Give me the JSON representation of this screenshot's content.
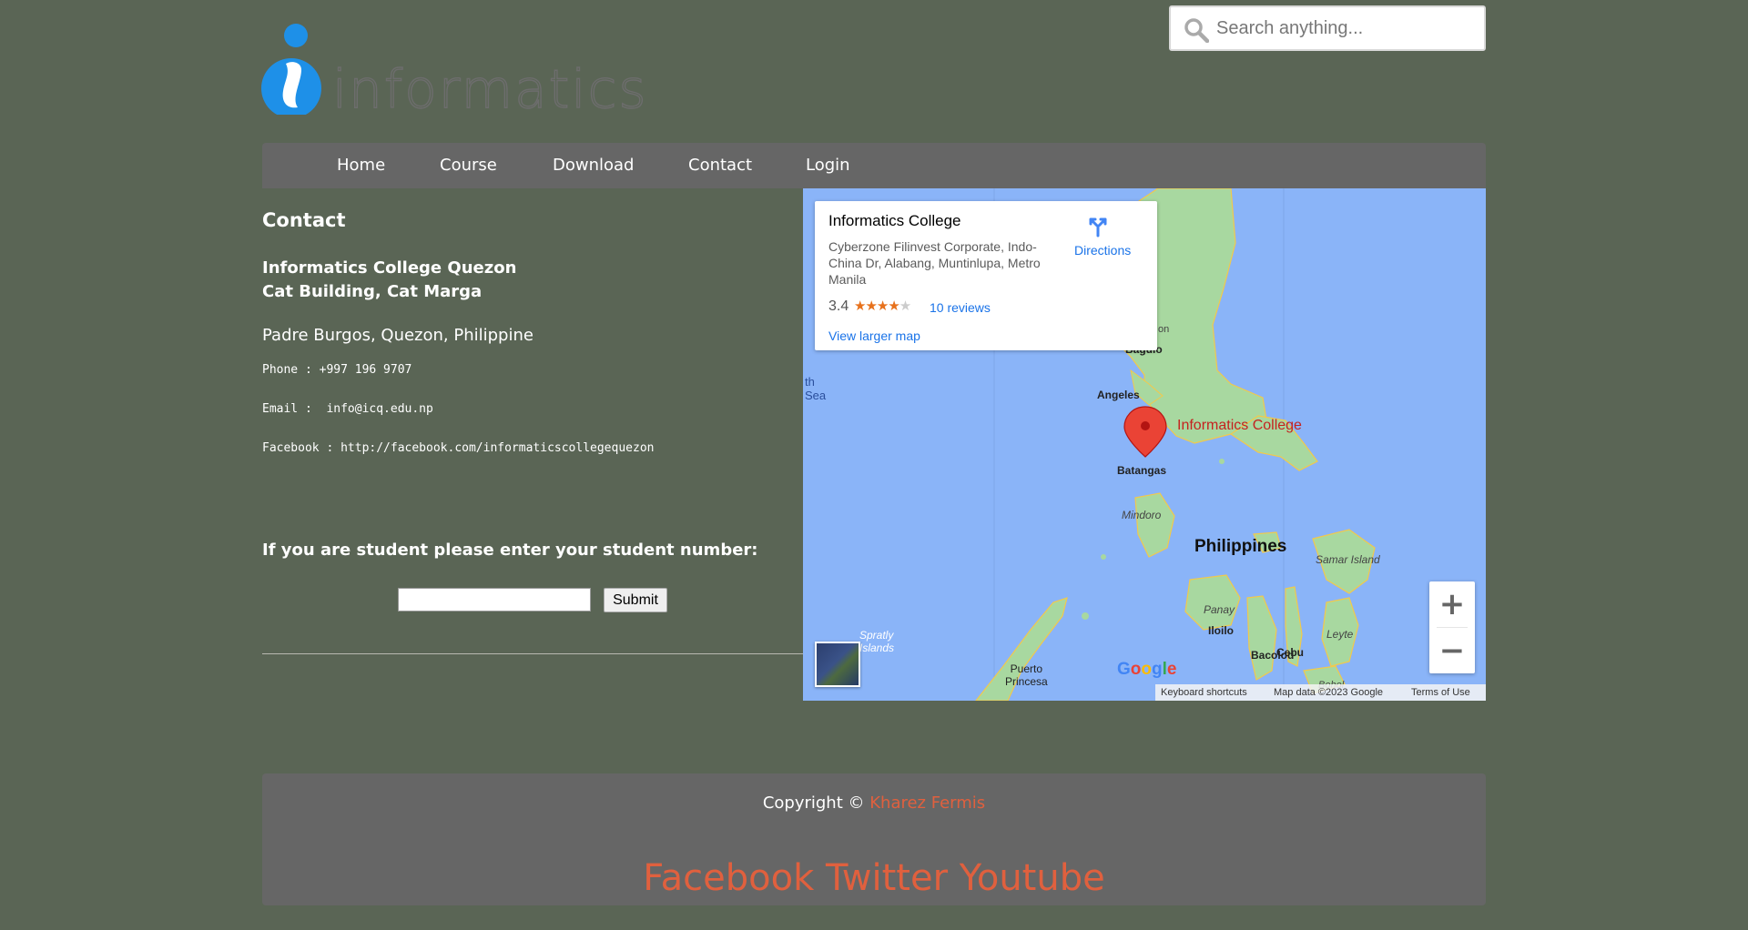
{
  "brand": {
    "logo_text": "informatics",
    "accent_color": "#1e90e8"
  },
  "search": {
    "placeholder": "Search anything..."
  },
  "nav": {
    "items": [
      {
        "label": "Home"
      },
      {
        "label": "Course"
      },
      {
        "label": "Download"
      },
      {
        "label": "Contact"
      },
      {
        "label": "Login"
      }
    ]
  },
  "contact": {
    "title": "Contact",
    "school_line1": "Informatics College Quezon",
    "school_line2": "Cat Building, Cat Marga",
    "address": "Padre Burgos, Quezon, Philippine",
    "phone": "Phone : +997 196 9707",
    "email": "Email :  info@icq.edu.np",
    "facebook": "Facebook : http://facebook.com/informaticscollegequezon",
    "student_prompt": "If you are student please enter your student number:",
    "submit_label": "Submit"
  },
  "map": {
    "card": {
      "title": "Informatics College",
      "address": "Cyberzone Filinvest Corporate, Indo-China Dr, Alabang, Muntinlupa, Metro Manila",
      "rating": "3.4",
      "stars": "★★★★★",
      "reviews": "10 reviews",
      "larger_map": "View larger map",
      "directions": "Directions"
    },
    "labels": {
      "pin": "Informatics College",
      "baguio": "Baguio",
      "angeles": "Angeles",
      "batangas": "Batangas",
      "mindoro": "Mindoro",
      "philippines": "Philippines",
      "samar": "Samar Island",
      "panay": "Panay",
      "iloilo": "Iloilo",
      "bacolod": "Bacolod",
      "cebu": "Cebu",
      "leyte": "Leyte",
      "puerto_princesa_1": "Puerto",
      "puerto_princesa_2": "Princesa",
      "spratly_1": "Spratly",
      "spratly_2": "Islands",
      "sea_1": "th",
      "sea_2": "Sea",
      "luzon_partial": "on",
      "bohol_partial": "Bohol"
    },
    "zoom_in": "+",
    "zoom_out": "−",
    "google": "Google",
    "footer": {
      "shortcuts": "Keyboard shortcuts",
      "map_data": "Map data ©2023 Google",
      "terms": "Terms of Use"
    }
  },
  "footer": {
    "copyright_prefix": "Copyright ©",
    "copyright_name": "Kharez Fermis",
    "social": [
      "Facebook",
      "Twitter",
      "Youtube"
    ]
  }
}
